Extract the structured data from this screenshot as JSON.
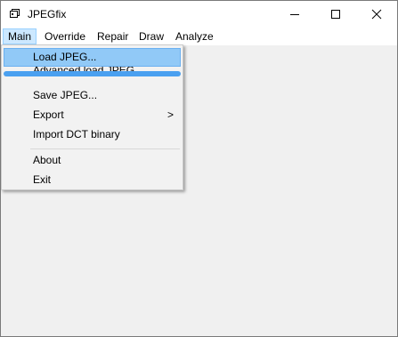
{
  "window": {
    "title": "JPEGfix",
    "icon": "app-window-icon",
    "controls": [
      "minimize-icon",
      "maximize-icon",
      "close-icon"
    ]
  },
  "menubar": {
    "items": [
      {
        "label": "Main",
        "active": true
      },
      {
        "label": "Override"
      },
      {
        "label": "Repair"
      },
      {
        "label": "Draw"
      },
      {
        "label": "Analyze"
      }
    ]
  },
  "main_menu": {
    "items": [
      {
        "label": "Load JPEG...",
        "highlighted": true
      },
      {
        "label": "Advanced load JPEG..."
      },
      {
        "label": "Save JPEG..."
      },
      {
        "label": "Export",
        "submenu_arrow": ">"
      },
      {
        "label": "Import DCT binary"
      },
      {
        "label": "About"
      },
      {
        "label": "Exit"
      }
    ]
  },
  "colors": {
    "highlight": "#91c9f7",
    "menubar_active": "#cce8ff",
    "background": "#f0f0f0"
  }
}
